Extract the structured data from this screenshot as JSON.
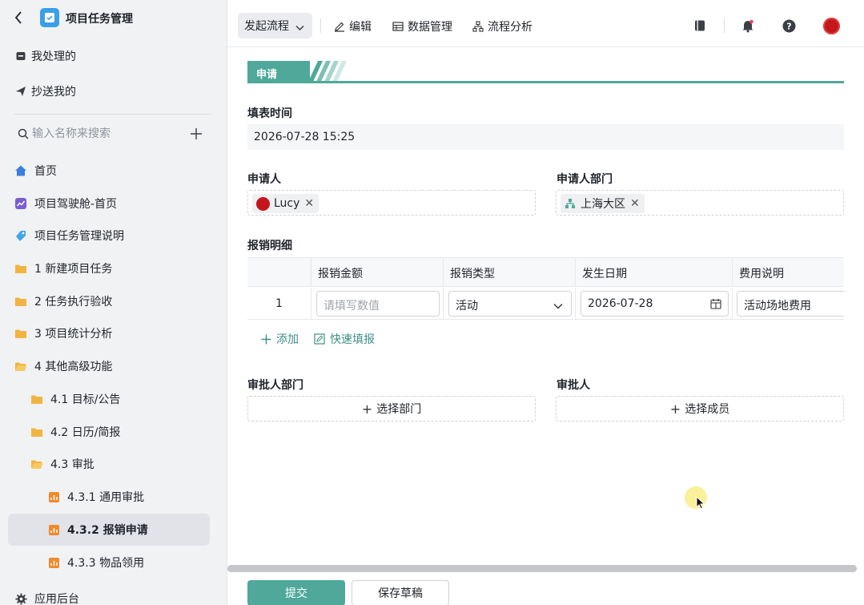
{
  "sidebar": {
    "app_title": "项目任务管理",
    "my_processed": "我处理的",
    "cc_to_me": "抄送我的",
    "search_placeholder": "输入名称来搜索",
    "items": [
      {
        "label": "首页",
        "icon": "home-icon"
      },
      {
        "label": "项目驾驶舱-首页",
        "icon": "chart-icon"
      },
      {
        "label": "项目任务管理说明",
        "icon": "tag-icon"
      },
      {
        "label": "1 新建项目任务",
        "icon": "folder-icon"
      },
      {
        "label": "2 任务执行验收",
        "icon": "folder-icon"
      },
      {
        "label": "3 项目统计分析",
        "icon": "folder-icon"
      },
      {
        "label": "4 其他高级功能",
        "icon": "folder-open-icon"
      },
      {
        "label": "4.1 目标/公告",
        "icon": "folder-icon"
      },
      {
        "label": "4.2 日历/简报",
        "icon": "folder-icon"
      },
      {
        "label": "4.3 审批",
        "icon": "folder-open-icon"
      },
      {
        "label": "4.3.1 通用审批",
        "icon": "form-icon"
      },
      {
        "label": "4.3.2 报销申请",
        "icon": "form-icon"
      },
      {
        "label": "4.3.3 物品领用",
        "icon": "form-icon"
      }
    ],
    "admin_label": "应用后台"
  },
  "toolbar": {
    "start_flow": "发起流程",
    "edit": "编辑",
    "data_manage": "数据管理",
    "flow_analysis": "流程分析"
  },
  "form": {
    "section_title": "申请",
    "fill_time_label": "填表时间",
    "fill_time_value": "2026-07-28 15:25",
    "applicant_label": "申请人",
    "applicant_value": "Lucy",
    "dept_label": "申请人部门",
    "dept_value": "上海大区",
    "detail_label": "报销明细",
    "table": {
      "headers": [
        "报销金额",
        "报销类型",
        "发生日期",
        "费用说明"
      ],
      "row_index": "1",
      "amount_placeholder": "请填写数值",
      "type_value": "活动",
      "date_value": "2026-07-28",
      "desc_value": "活动场地费用"
    },
    "add_label": "添加",
    "quick_fill_label": "快速填报",
    "approver_dept_label": "审批人部门",
    "approver_label": "审批人",
    "select_dept": "选择部门",
    "select_member": "选择成员"
  },
  "footer": {
    "submit": "提交",
    "save_draft": "保存草稿"
  },
  "colors": {
    "accent": "#4fa89a",
    "sidebar_bg": "#f1f2f4",
    "folder": "#f2b441",
    "form_icon": "#f08a2c"
  }
}
